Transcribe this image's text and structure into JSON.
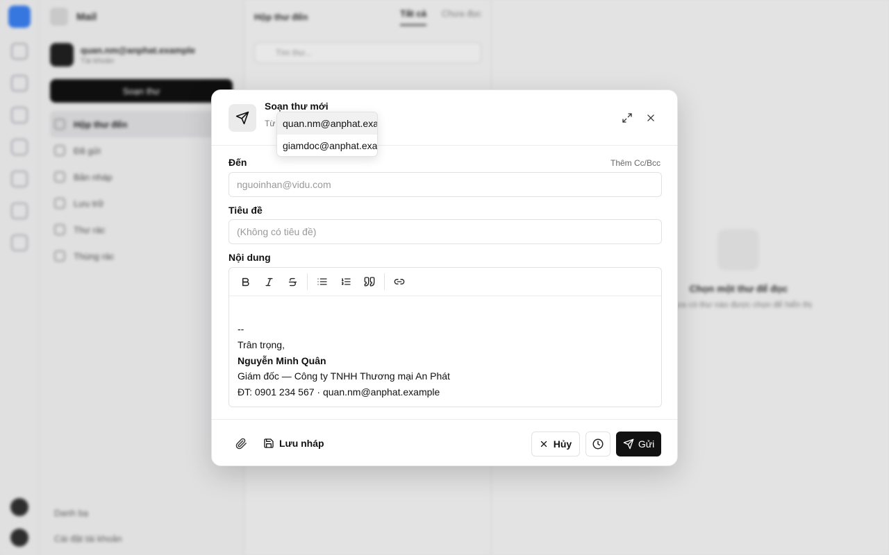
{
  "background": {
    "app_name": "Mail",
    "account": {
      "email": "quan.nm@anphat.example",
      "subtitle": "Tài khoản"
    },
    "compose_label": "Soạn thư",
    "nav_items": [
      "Hộp thư đến",
      "Đã gửi",
      "Bản nháp",
      "Lưu trữ",
      "Thư rác",
      "Thùng rác"
    ],
    "footer_items": [
      "Danh bạ",
      "Cài đặt tài khoản"
    ],
    "list_title": "Hộp thư đến",
    "tabs": [
      "Tất cả",
      "Chưa đọc"
    ],
    "search_placeholder": "Tìm thư...",
    "empty_title": "Chọn một thư để đọc",
    "empty_sub": "Chưa có thư nào được chọn để hiển thị"
  },
  "dialog": {
    "title": "Soạn thư mới",
    "from_label": "Từ",
    "from_options": [
      "quan.nm@anphat.example",
      "giamdoc@anphat.example"
    ],
    "to_label": "Đến",
    "cc_bcc_link": "Thêm Cc/Bcc",
    "to_placeholder": "nguoinhan@vidu.com",
    "subject_label": "Tiêu đề",
    "subject_placeholder": "(Không có tiêu đề)",
    "body_label": "Nội dung",
    "signature": {
      "separator": "--",
      "closing": "Trân trọng,",
      "name": "Nguyễn Minh Quân",
      "position": "Giám đốc — Công ty TNHH Thương mại An Phát",
      "contact": "ĐT: 0901 234 567 · quan.nm@anphat.example"
    },
    "save_draft_label": "Lưu nháp",
    "cancel_label": "Hủy",
    "send_label": "Gửi"
  }
}
